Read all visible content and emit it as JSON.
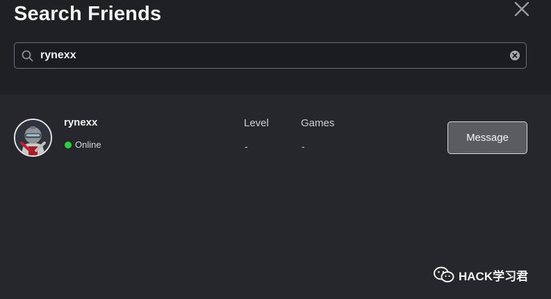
{
  "modal": {
    "title": "Search Friends",
    "close_icon": "close-icon"
  },
  "search": {
    "value": "rynexx",
    "placeholder": "",
    "search_icon": "search-icon",
    "clear_icon": "clear-circle-icon"
  },
  "results": [
    {
      "username": "rynexx",
      "status": "Online",
      "status_color": "#2ecc40",
      "avatar_icon": "robot-avatar-icon",
      "level_label": "Level",
      "level_value": "-",
      "games_label": "Games",
      "games_value": "-",
      "message_label": "Message"
    }
  ],
  "watermark": {
    "text": "HACK学习君",
    "logo_icon": "wechat-logo-icon"
  },
  "colors": {
    "background": "#25272c",
    "header_background": "#1f2024",
    "online": "#2ecc40",
    "button_background": "#5a5c61"
  }
}
